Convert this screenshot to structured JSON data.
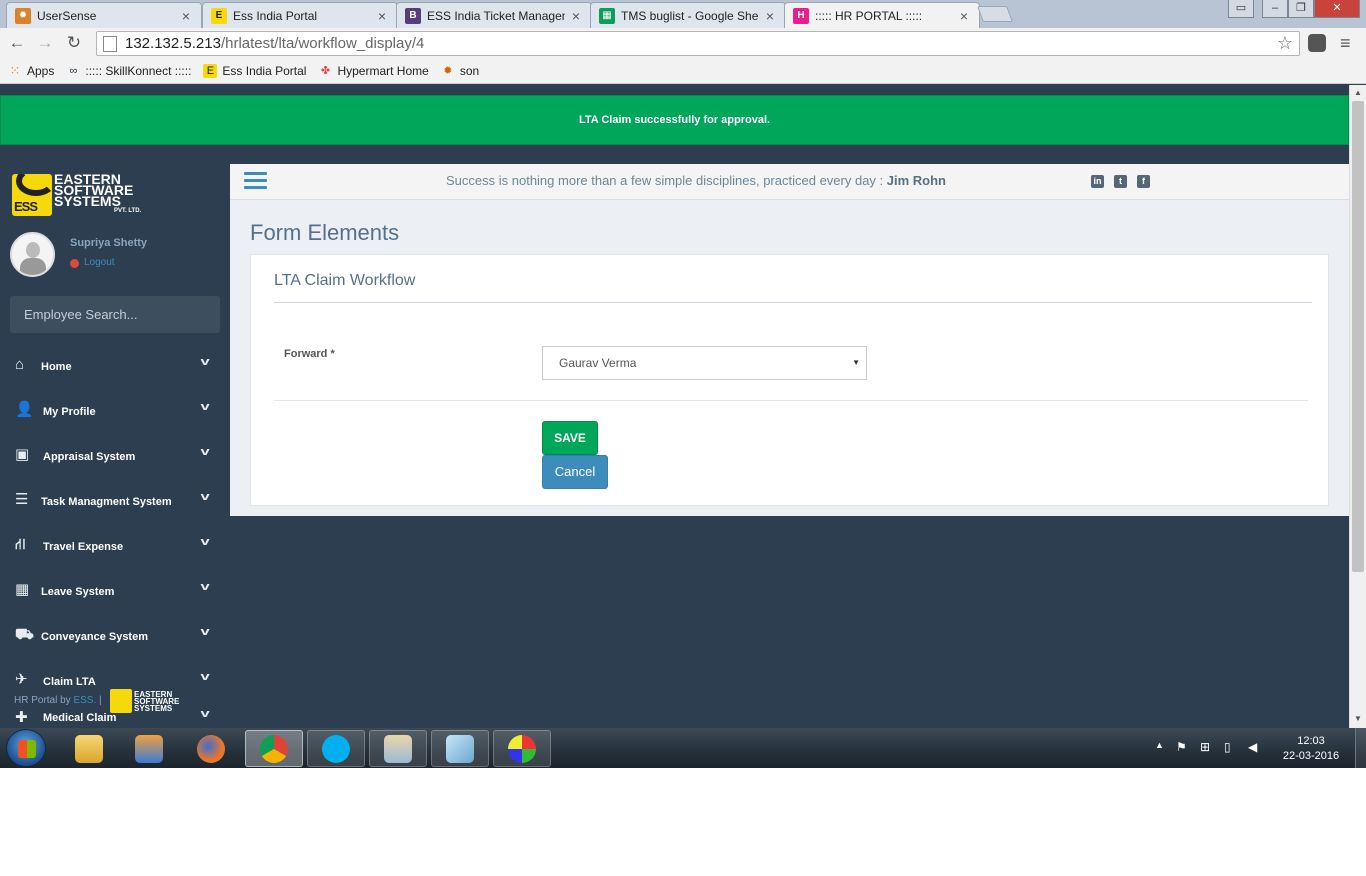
{
  "browser": {
    "tabs": [
      {
        "title": "UserSense",
        "active": false
      },
      {
        "title": "Ess India Portal",
        "active": false
      },
      {
        "title": "ESS India Ticket Managem",
        "active": false
      },
      {
        "title": "TMS buglist - Google She",
        "active": false
      },
      {
        "title": "::::: HR PORTAL :::::",
        "active": true
      }
    ],
    "address": {
      "host": "132.132.5.213",
      "path": "/hrlatest/lta/workflow_display/4"
    },
    "bookmarks": [
      {
        "label": "Apps",
        "icon": "apps-grid-icon"
      },
      {
        "label": "::::: SkillKonnect :::::",
        "icon": "skillkonnect-icon"
      },
      {
        "label": "Ess India Portal",
        "icon": "ess-icon"
      },
      {
        "label": "Hypermart Home",
        "icon": "joomla-icon"
      },
      {
        "label": "son",
        "icon": "bug-icon"
      }
    ]
  },
  "alert": {
    "message": "LTA Claim successfully for approval."
  },
  "sidebar": {
    "logo": {
      "line1": "EASTERN",
      "line2": "SOFTWARE",
      "line3": "SYSTEMS",
      "line4": "PVT. LTD.",
      "mark": "ESS"
    },
    "user": {
      "name": "Supriya Shetty",
      "logout": "Logout"
    },
    "search_placeholder": "Employee Search...",
    "menu": [
      {
        "label": "Home",
        "icon": "home-icon"
      },
      {
        "label": "My Profile",
        "icon": "user-icon"
      },
      {
        "label": "Appraisal System",
        "icon": "money-icon"
      },
      {
        "label": "Task Managment System",
        "icon": "list-icon"
      },
      {
        "label": "Travel Expense",
        "icon": "road-icon"
      },
      {
        "label": "Leave System",
        "icon": "calendar-icon"
      },
      {
        "label": "Conveyance System",
        "icon": "truck-icon"
      },
      {
        "label": "Claim LTA",
        "icon": "plane-icon"
      },
      {
        "label": "Medical Claim",
        "icon": "medkit-icon"
      }
    ],
    "footer": {
      "prefix": "HR Portal by",
      "link": "ESS.",
      "separator": "|"
    }
  },
  "header": {
    "quote": "Success is nothing more than a few simple disciplines, practiced every day : ",
    "author": "Jim Rohn",
    "social": [
      "linkedin-icon",
      "twitter-icon",
      "facebook-icon"
    ]
  },
  "main": {
    "page_title": "Form Elements",
    "box_title": "LTA Claim Workflow",
    "forward_label": "Forward *",
    "forward_value": "Gaurav Verma",
    "save_label": "SAVE",
    "cancel_label": "Cancel"
  },
  "taskbar": {
    "apps": [
      "explorer-icon",
      "media-player-icon",
      "firefox-icon",
      "chrome-icon",
      "skype-icon",
      "app-window-icon",
      "notes-icon",
      "paint-icon"
    ],
    "time": "12:03",
    "date": "22-03-2016"
  },
  "colors": {
    "success": "#00a65a",
    "primary": "#3c8dbc",
    "sidebar": "#2c3e50"
  }
}
